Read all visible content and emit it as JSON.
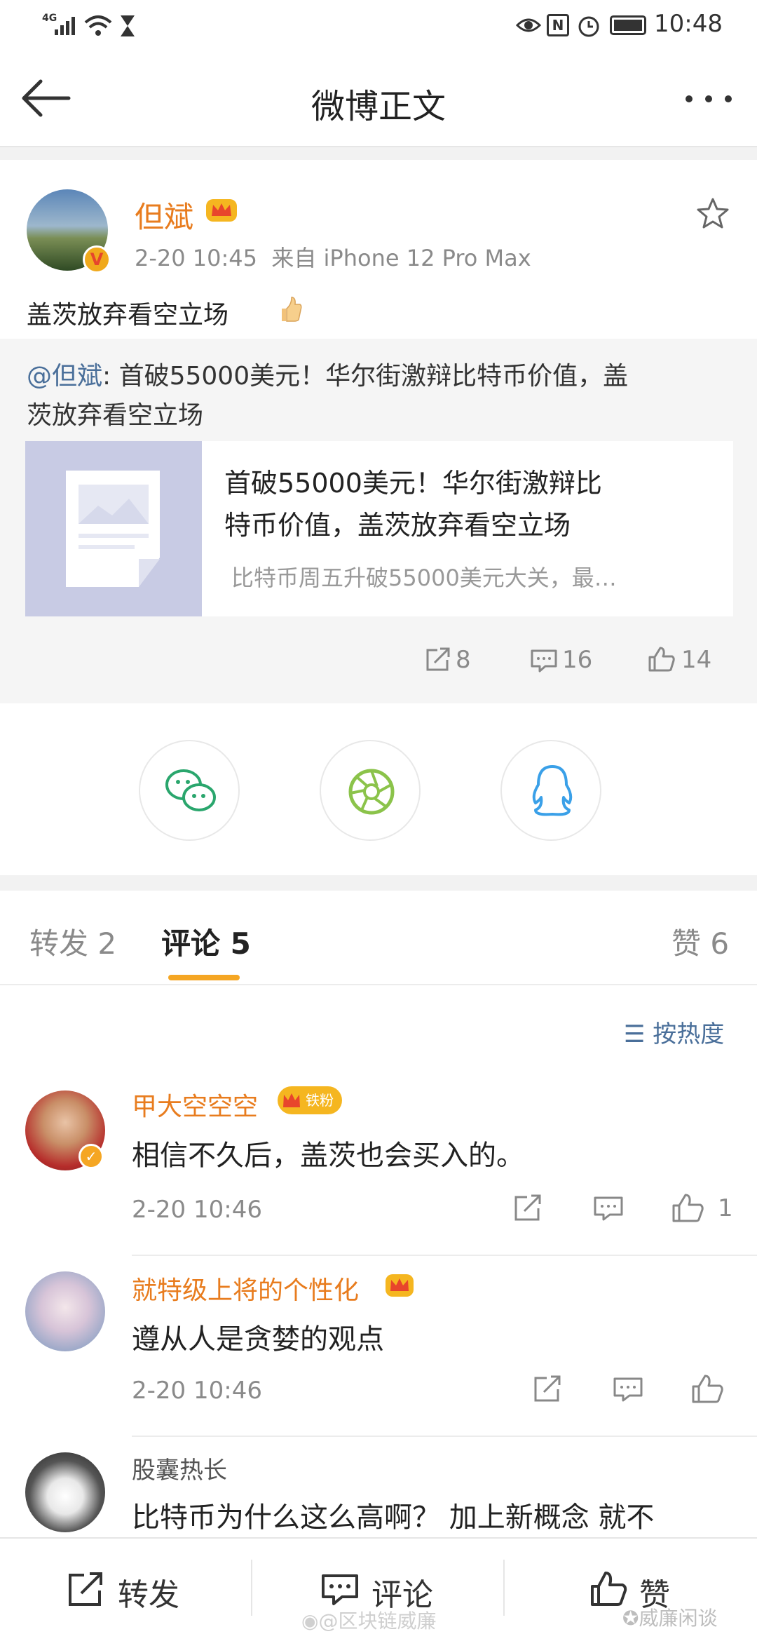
{
  "status_bar": {
    "signal_label": "4G",
    "time": "10:48",
    "nfc_label": "N"
  },
  "nav": {
    "title": "微博正文"
  },
  "post": {
    "author": "但斌",
    "meta": "2-20 10:45  来自 iPhone 12 Pro Max",
    "text": "盖茨放弃看空立场",
    "vip_badge": "V"
  },
  "quote": {
    "mention": "@但斌",
    "text_line1": ": 首破55000美元！华尔街激辩比特币价值，盖",
    "text_line2": "茨放弃看空立场",
    "card_title_line1": "首破55000美元！华尔街激辩比",
    "card_title_line2": "特币价值，盖茨放弃看空立场",
    "card_summary": "比特币周五升破55000美元大关，最…",
    "repost_count": "8",
    "comment_count": "16",
    "like_count": "14"
  },
  "tabs": {
    "repost": "转发 2",
    "comment": "评论 5",
    "like": "赞 6",
    "sort": "按热度",
    "sort_icon": "☰"
  },
  "comments": [
    {
      "name": "甲大空空空",
      "fan_badge": "铁粉",
      "text": "相信不久后，盖茨也会买入的。",
      "time": "2-20 10:46",
      "likes": "1"
    },
    {
      "name": "就特级上将的个性化",
      "text": "遵从人是贪婪的观点",
      "time": "2-20 10:46",
      "likes": ""
    },
    {
      "name": "股囊热长",
      "text": "比特币为什么这么高啊？ 加上新概念 就不"
    }
  ],
  "bottom": {
    "repost": "转发",
    "comment": "评论",
    "like": "赞",
    "watermark_left": "@区块链威廉",
    "watermark_right": "威廉闲谈"
  },
  "colors": {
    "accent": "#e87c1e",
    "tab_underline": "#f5a623",
    "link": "#4a6f9a"
  }
}
